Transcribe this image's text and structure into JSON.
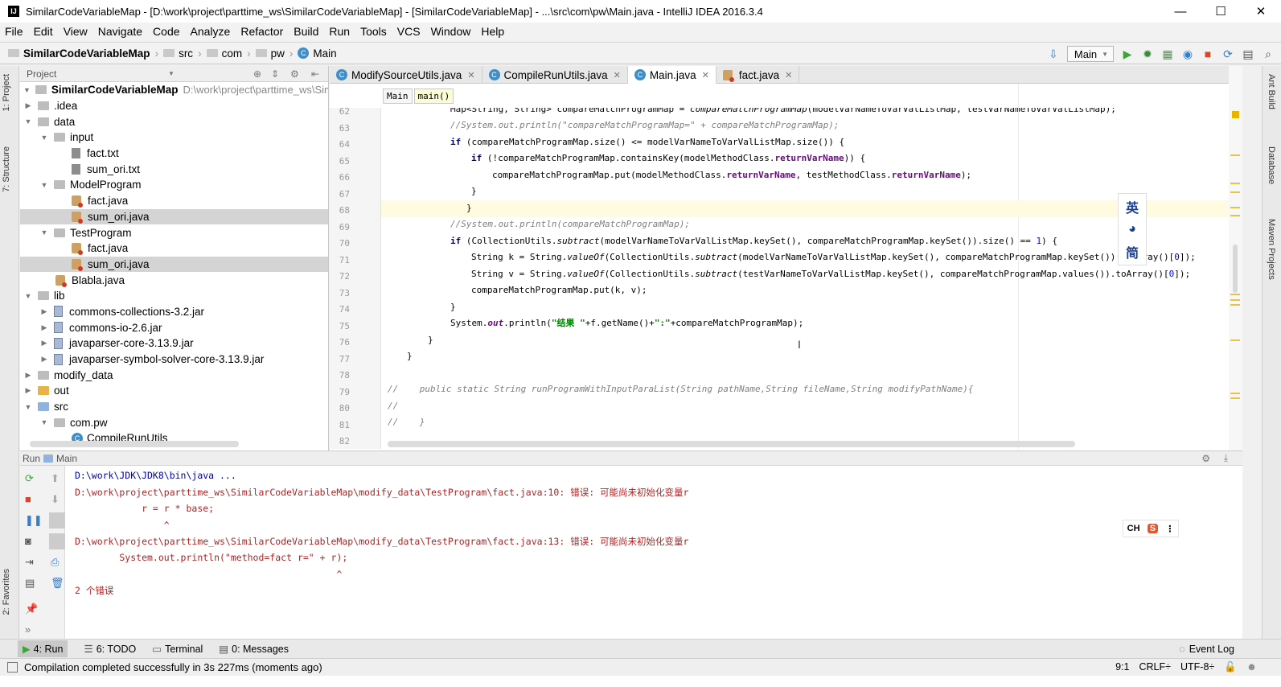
{
  "window": {
    "title": "SimilarCodeVariableMap - [D:\\work\\project\\parttime_ws\\SimilarCodeVariableMap] - [SimilarCodeVariableMap] - ...\\src\\com\\pw\\Main.java - IntelliJ IDEA 2016.3.4",
    "minimize": "—",
    "maximize": "☐",
    "close": "✕"
  },
  "menu": [
    "File",
    "Edit",
    "View",
    "Navigate",
    "Code",
    "Analyze",
    "Refactor",
    "Build",
    "Run",
    "Tools",
    "VCS",
    "Window",
    "Help"
  ],
  "navbar": {
    "project": "SimilarCodeVariableMap",
    "crumbs": [
      "src",
      "com",
      "pw"
    ],
    "current": "Main",
    "run_config": "Main"
  },
  "left_strip": {
    "project_tab": "1: Project",
    "structure_tab": "7: Structure",
    "favorites_tab": "2: Favorites"
  },
  "right_strip": {
    "ant": "Ant Build",
    "database": "Database",
    "maven": "Maven Projects"
  },
  "project_panel": {
    "title": "Project",
    "tree": [
      {
        "label": "SimilarCodeVariableMap",
        "extra": "D:\\work\\project\\parttime_ws\\Simi"
      },
      {
        "label": ".idea"
      },
      {
        "label": "data"
      },
      {
        "label": "input"
      },
      {
        "label": "fact.txt"
      },
      {
        "label": "sum_ori.txt"
      },
      {
        "label": "ModelProgram"
      },
      {
        "label": "fact.java"
      },
      {
        "label": "sum_ori.java"
      },
      {
        "label": "TestProgram"
      },
      {
        "label": "fact.java"
      },
      {
        "label": "sum_ori.java"
      },
      {
        "label": "Blabla.java"
      },
      {
        "label": "lib"
      },
      {
        "label": "commons-collections-3.2.jar"
      },
      {
        "label": "commons-io-2.6.jar"
      },
      {
        "label": "javaparser-core-3.13.9.jar"
      },
      {
        "label": "javaparser-symbol-solver-core-3.13.9.jar"
      },
      {
        "label": "modify_data"
      },
      {
        "label": "out"
      },
      {
        "label": "src"
      },
      {
        "label": "com.pw"
      },
      {
        "label": "CompileRunUtils"
      }
    ]
  },
  "editor": {
    "tabs": [
      "ModifySourceUtils.java",
      "CompileRunUtils.java",
      "Main.java",
      "fact.java"
    ],
    "active_tab": "Main.java",
    "breadcrumbs": [
      "Main",
      "main()"
    ],
    "line_numbers": [
      "62",
      "63",
      "64",
      "65",
      "66",
      "67",
      "68",
      "69",
      "70",
      "71",
      "72",
      "73",
      "74",
      "75",
      "76",
      "77",
      "78",
      "79",
      "80",
      "81",
      "82"
    ],
    "current_line": "68"
  },
  "ime_vertical": [
    "英",
    "◕",
    "简"
  ],
  "run_panel": {
    "label": "Run",
    "config": "Main",
    "console": [
      {
        "text": "D:\\work\\JDK\\JDK8\\bin\\java ...",
        "kind": "cmd"
      },
      {
        "text": "D:\\work\\project\\parttime_ws\\SimilarCodeVariableMap\\modify_data\\TestProgram\\fact.java:10: 错误: 可能尚未初始化变量r",
        "kind": "err"
      },
      {
        "text": "            r = r * base;",
        "kind": "err"
      },
      {
        "text": "                ^",
        "kind": "err"
      },
      {
        "text": "D:\\work\\project\\parttime_ws\\SimilarCodeVariableMap\\modify_data\\TestProgram\\fact.java:13: 错误: 可能尚未初始化变量r",
        "kind": "err"
      },
      {
        "text": "        System.out.println(\"method=fact r=\" + r);",
        "kind": "err"
      },
      {
        "text": "                                               ^",
        "kind": "err"
      },
      {
        "text": "2 个错误",
        "kind": "err"
      }
    ]
  },
  "ime_badge": {
    "lang": "CH",
    "logo": "S"
  },
  "toolwindows": {
    "run": "4: Run",
    "todo": "6: TODO",
    "terminal": "Terminal",
    "messages": "0: Messages",
    "event_log": "Event Log"
  },
  "status": {
    "message": "Compilation completed successfully in 3s 227ms (moments ago)",
    "position": "9:1",
    "line_sep": "CRLF÷",
    "encoding": "UTF-8÷"
  },
  "colors": {
    "keyword": "#000080",
    "comment": "#808080",
    "field": "#660e7a",
    "string": "#008000",
    "error": "#b22222",
    "caret_line": "#fffbe0"
  }
}
